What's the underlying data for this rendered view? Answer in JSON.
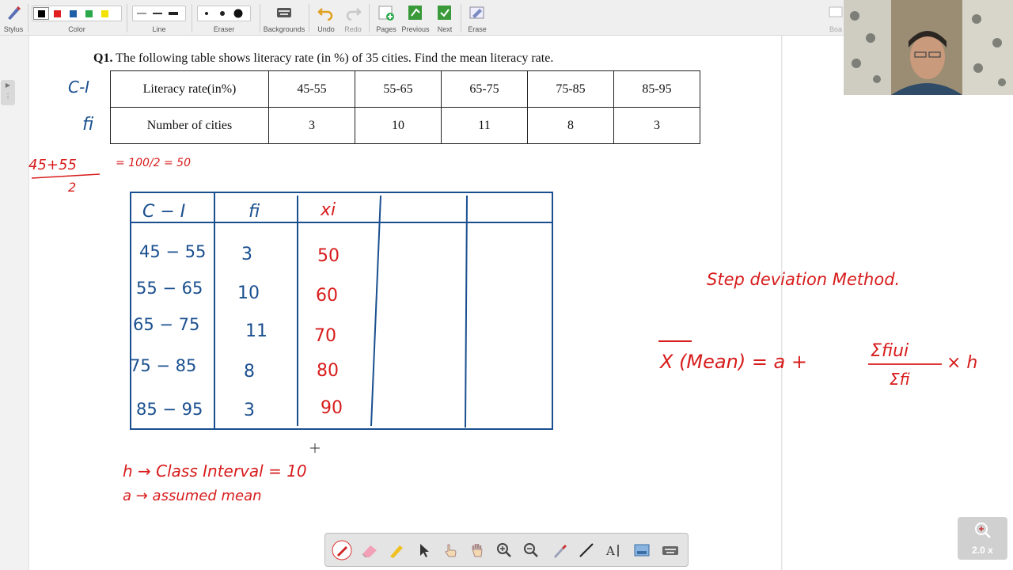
{
  "toolbar": {
    "stylus": "Stylus",
    "color": "Color",
    "line": "Line",
    "eraser": "Eraser",
    "backgrounds": "Backgrounds",
    "undo": "Undo",
    "redo": "Redo",
    "pages": "Pages",
    "previous": "Previous",
    "next": "Next",
    "erase": "Erase",
    "board": "Boa",
    "swatches": [
      "#000000",
      "#e02020",
      "#1f5fa8",
      "#2aa84a",
      "#f2e200"
    ]
  },
  "question": {
    "number": "Q1.",
    "text": "The following table shows literacy rate (in %) of 35 cities. Find the mean literacy rate."
  },
  "table": {
    "row1_header": "Literacy rate(in%)",
    "row1": [
      "45-55",
      "55-65",
      "65-75",
      "75-85",
      "85-95"
    ],
    "row2_header": "Number of cities",
    "row2": [
      "3",
      "10",
      "11",
      "8",
      "3"
    ]
  },
  "handwriting": {
    "ci_label": "C-I",
    "fi_label": "fi",
    "calc_top": "45+55",
    "calc_bottom": "2",
    "calc_rest": "= 100/2 = 50",
    "grid_headers": [
      "C − I",
      "fi",
      "xi"
    ],
    "grid_ci": [
      "45 − 55",
      "55 − 65",
      "65 − 75",
      "75 − 85",
      "85 − 95"
    ],
    "grid_fi": [
      "3",
      "10",
      "11",
      "8",
      "3"
    ],
    "grid_xi": [
      "50",
      "60",
      "70",
      "80",
      "90"
    ],
    "h_note": "h → Class Interval = 10",
    "a_note": "a → assumed mean",
    "method": "Step deviation Method.",
    "formula_left": "X (Mean) =  a +",
    "formula_num": "Σfiui",
    "formula_den": "Σfi",
    "formula_right": "× h"
  },
  "zoom": {
    "level": "2.0 x"
  },
  "colors": {
    "ink_blue": "#1a4f8f",
    "ink_red": "#d81c1c"
  }
}
